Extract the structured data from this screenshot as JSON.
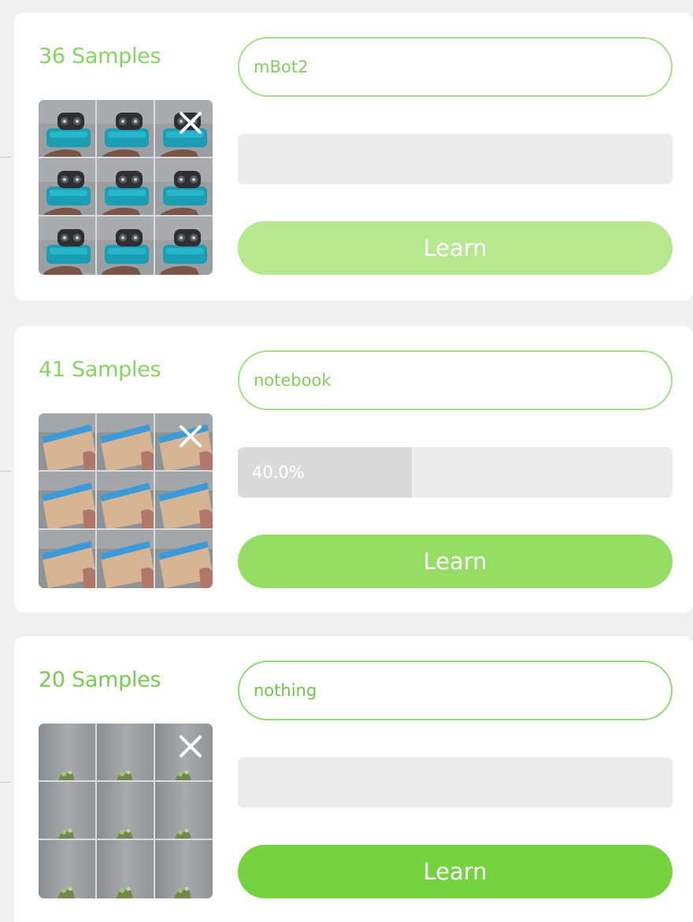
{
  "cards": [
    {
      "sample_count_label": "36 Samples",
      "name_value": "mBot2",
      "progress_label": "",
      "progress_fraction": 0,
      "learn_label": "Learn",
      "learn_button_color": "#b5e88f",
      "remove_icon": "close-icon",
      "thumbnail": "mbot2-robot"
    },
    {
      "sample_count_label": "41 Samples",
      "name_value": "notebook",
      "progress_label": "40.0%",
      "progress_fraction": 0.4,
      "learn_label": "Learn",
      "learn_button_color": "#93de63",
      "remove_icon": "close-icon",
      "thumbnail": "notebook"
    },
    {
      "sample_count_label": "20 Samples",
      "name_value": "nothing",
      "progress_label": "",
      "progress_fraction": 0,
      "learn_label": "Learn",
      "learn_button_color": "#75d33f",
      "remove_icon": "close-icon",
      "thumbnail": "empty-background"
    }
  ],
  "colors": {
    "accent_green": "#86d462",
    "input_border": "#a6df89",
    "page_background": "#f0f0f0",
    "track": "#ececec",
    "track_fill": "#dadada"
  }
}
